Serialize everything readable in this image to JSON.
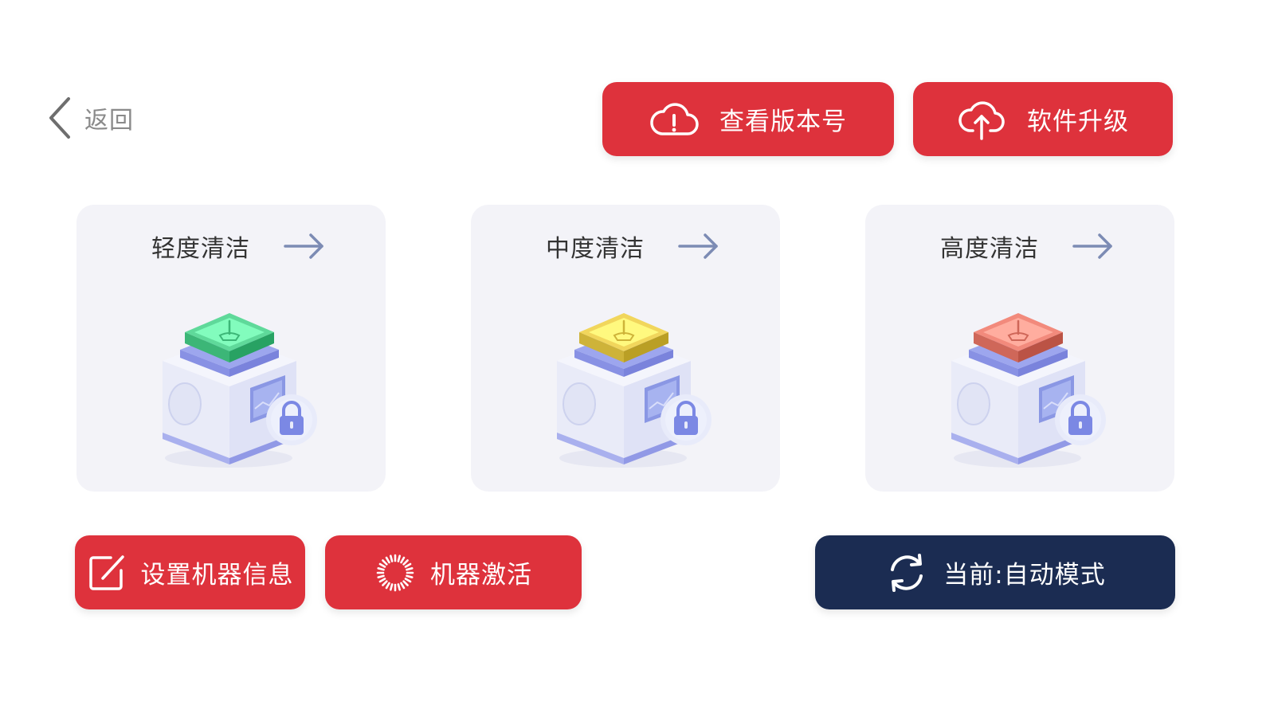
{
  "header": {
    "back_label": "返回"
  },
  "toolbar": {
    "version_label": "查看版本号",
    "upgrade_label": "软件升级"
  },
  "cards": [
    {
      "title": "轻度清洁",
      "level": "light",
      "accent": "#5fd99a"
    },
    {
      "title": "中度清洁",
      "level": "medium",
      "accent": "#f1d65c"
    },
    {
      "title": "高度清洁",
      "level": "heavy",
      "accent": "#f28a7c"
    }
  ],
  "actions": {
    "set_info_label": "设置机器信息",
    "activate_label": "机器激活",
    "mode_label": "当前:自动模式"
  },
  "colors": {
    "primary_red": "#de323c",
    "navy": "#1b2c52",
    "card_bg": "#f3f3f8",
    "arrow": "#7c8bb4"
  },
  "icons": {
    "back": "chevron-left-icon",
    "version": "cloud-alert-icon",
    "upgrade": "cloud-upload-icon",
    "card_arrow": "arrow-right-icon",
    "set_info": "edit-icon",
    "activate": "activate-icon",
    "mode": "refresh-icon",
    "card_illustration": "locked-cleaning-box-icon"
  }
}
